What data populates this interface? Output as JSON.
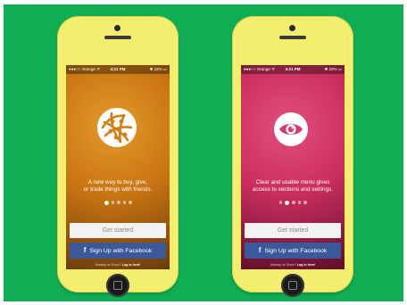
{
  "background_color": "#0fae55",
  "phone_color": "#f3ee6e",
  "phones": [
    {
      "theme": "orange",
      "accent": "#d2801a",
      "icon": "globe-network-icon",
      "status": {
        "carrier": "●●●○○ Orange ᯤ",
        "time": "4:21 PM",
        "battery": "✱ 22% ▭"
      },
      "tagline": [
        "A new way to buy, give,",
        "or trade things with friends."
      ],
      "pager": {
        "count": 5,
        "active_index": 0
      },
      "get_started_label": "Get started",
      "facebook_label": "Sign Up with Facebook",
      "facebook_icon": "f",
      "already_text": "Already on Sonic?",
      "login_link": "Log in here!"
    },
    {
      "theme": "pink",
      "accent": "#d63a6b",
      "icon": "eye-icon",
      "status": {
        "carrier": "●●●○○ Orange ᯤ",
        "time": "4:21 PM",
        "battery": "✱ 22% ▭"
      },
      "tagline": [
        "Clear and usable menu gives",
        "access to sections and settings."
      ],
      "pager": {
        "count": 5,
        "active_index": 1
      },
      "get_started_label": "Get started",
      "facebook_label": "Sign Up with Facebook",
      "facebook_icon": "f",
      "already_text": "Already on Sonic?",
      "login_link": "Log in here!"
    }
  ]
}
